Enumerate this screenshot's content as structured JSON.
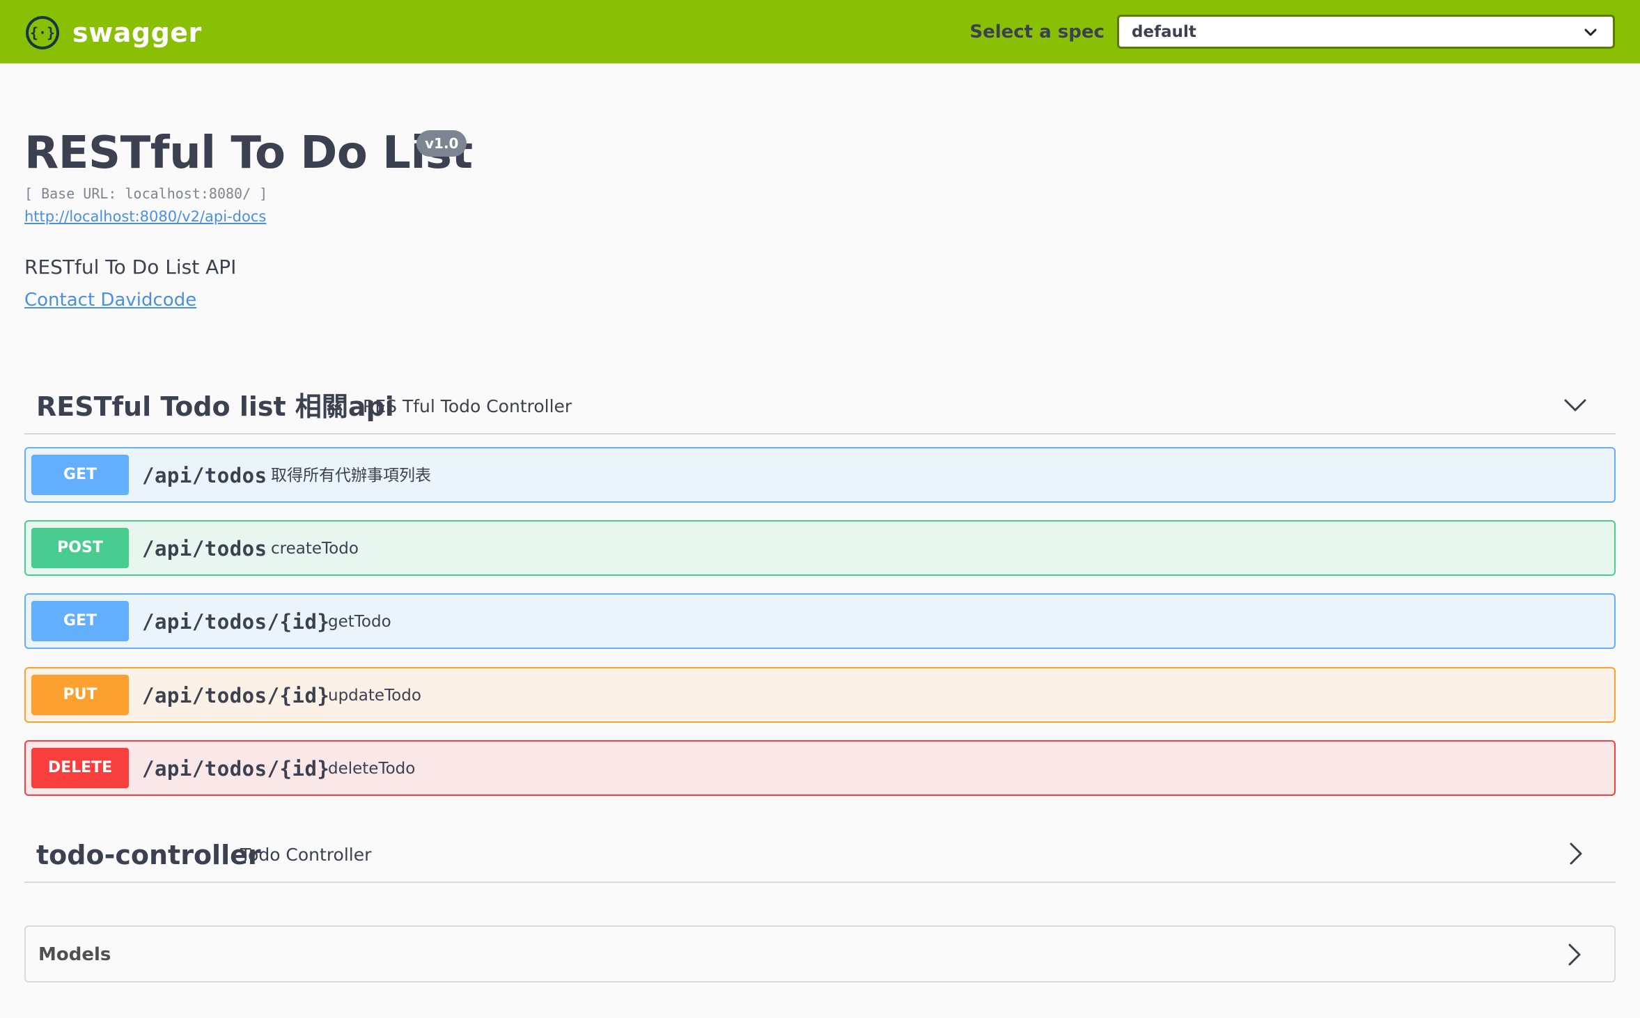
{
  "topbar": {
    "logo_icon": "swagger-braces-icon",
    "logo_text": "swagger",
    "spec_label": "Select a spec",
    "spec_value": "default",
    "colors": {
      "bar": "#89bf04"
    }
  },
  "info": {
    "title": "RESTful To Do List",
    "version": "v1.0",
    "base_url": "[ Base URL: localhost:8080/ ]",
    "api_docs_link": "http://localhost:8080/v2/api-docs",
    "description": "RESTful To Do List API",
    "contact": "Contact Davidcode"
  },
  "tags": [
    {
      "name": "RESTful Todo list 相關api",
      "description": "RES Tful Todo Controller",
      "expanded": true,
      "chevron_icon": "chevron-down-icon",
      "operations": [
        {
          "method": "GET",
          "path": "/api/todos",
          "summary": "取得所有代辦事項列表"
        },
        {
          "method": "POST",
          "path": "/api/todos",
          "summary": "createTodo"
        },
        {
          "method": "GET",
          "path": "/api/todos/{id}",
          "summary": "getTodo"
        },
        {
          "method": "PUT",
          "path": "/api/todos/{id}",
          "summary": "updateTodo"
        },
        {
          "method": "DELETE",
          "path": "/api/todos/{id}",
          "summary": "deleteTodo"
        }
      ]
    },
    {
      "name": "todo-controller",
      "description": "Todo Controller",
      "expanded": false,
      "chevron_icon": "chevron-right-icon"
    }
  ],
  "models": {
    "title": "Models",
    "chevron_icon": "chevron-right-icon"
  },
  "method_colors": {
    "GET": "#61affe",
    "POST": "#49cc90",
    "PUT": "#fca130",
    "DELETE": "#f93e3e"
  }
}
